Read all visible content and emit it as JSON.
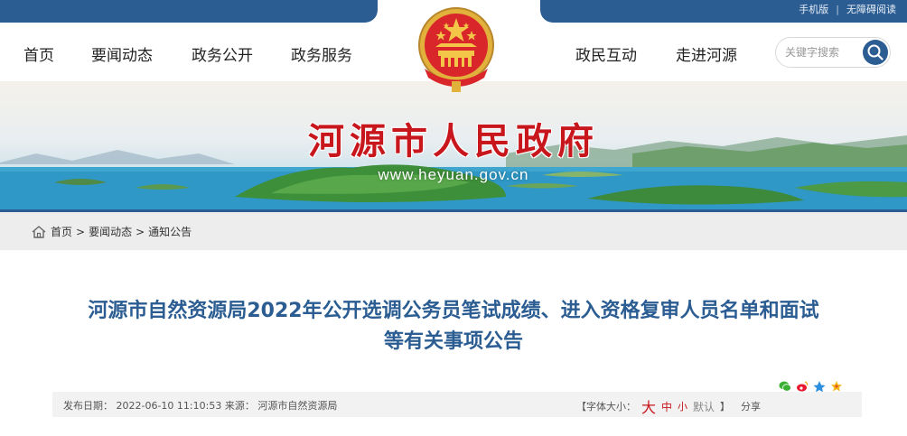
{
  "toplinks": {
    "mobile": "手机版",
    "separator": "|",
    "accessible": "无障碍阅读"
  },
  "nav": {
    "left": [
      "首页",
      "要闻动态",
      "政务公开",
      "政务服务"
    ],
    "right": [
      "政民互动",
      "走进河源"
    ]
  },
  "search": {
    "placeholder": "关键字搜索"
  },
  "banner": {
    "title": "河源市人民政府",
    "url": "www.heyuan.gov.cn"
  },
  "breadcrumb": {
    "items": [
      "首页",
      "要闻动态",
      "通知公告"
    ],
    "separator": ">"
  },
  "article": {
    "title_line1": "河源市自然资源局2022年公开选调公务员笔试成绩、进入资格复审人员名单和面试",
    "title_line2": "等有关事项公告",
    "publish_label": "发布日期：",
    "publish_date": "2022-06-10 11:10:53",
    "source_label": "来源：",
    "source": "河源市自然资源局",
    "font_size_label": "【字体大小：",
    "font_big": "大",
    "font_mid": "中",
    "font_small": "小",
    "font_default": "默认",
    "font_close": "】",
    "share": "分享"
  },
  "colors": {
    "primary": "#2b5d93",
    "red": "#c8161d",
    "gray_bar": "#ededed"
  },
  "icons": [
    "wechat-icon",
    "weibo-icon",
    "qzone-icon",
    "favorite-icon",
    "home-icon",
    "search-icon"
  ]
}
